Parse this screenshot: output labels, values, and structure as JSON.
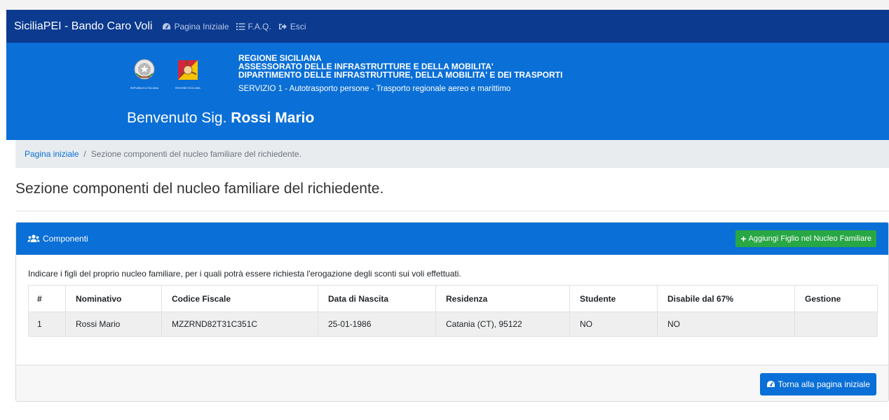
{
  "navbar": {
    "brand": "SiciliaPEI - Bando Caro Voli",
    "links": [
      {
        "label": "Pagina Iniziale",
        "icon": "tachometer-icon"
      },
      {
        "label": "F.A.Q.",
        "icon": "list-icon"
      },
      {
        "label": "Esci",
        "icon": "sign-out-icon"
      }
    ]
  },
  "header": {
    "emblems": [
      {
        "caption": "REPUBBLICA ITALIANA",
        "icon": "italian-republic-emblem"
      },
      {
        "caption": "REGIONE SICILIANA",
        "icon": "sicily-trinacria-flag"
      }
    ],
    "org_lines": [
      "REGIONE SICILIANA",
      "ASSESSORATO DELLE INFRASTRUTTURE E DELLA MOBILITA'",
      "DIPARTIMENTO DELLE INFRASTRUTTURE, DELLA MOBILITA' E DEI TRASPORTI"
    ],
    "service": "SERVIZIO 1 - Autotrasporto persone - Trasporto regionale aereo e marittimo",
    "welcome_prefix": "Benvenuto Sig.",
    "welcome_name": "Rossi Mario"
  },
  "breadcrumb": {
    "home": "Pagina iniziale",
    "separator": "/",
    "current": "Sezione componenti del nucleo familiare del richiedente."
  },
  "page_title": "Sezione componenti del nucleo familiare del richiedente.",
  "card": {
    "title": "Componenti",
    "add_button": "Aggiungi Figlio nel Nucleo Familiare",
    "intro": "Indicare i figli del proprio nucleo familiare, per i quali potrà essere richiesta l'erogazione degli sconti sui voli effettuati.",
    "table": {
      "columns": [
        "#",
        "Nominativo",
        "Codice Fiscale",
        "Data di Nascita",
        "Residenza",
        "Studente",
        "Disabile dal 67%",
        "Gestione"
      ],
      "rows": [
        [
          "1",
          "Rossi Mario",
          "MZZRND82T31C351C",
          "25-01-1986",
          "Catania (CT), 95122",
          "NO",
          "NO",
          ""
        ]
      ]
    },
    "back_button": "Torna alla pagina iniziale"
  },
  "colors": {
    "navbar": "#0b3a8f",
    "header": "#0a6fd6",
    "success": "#28a745",
    "breadcrumb_bg": "#e9ecef"
  }
}
